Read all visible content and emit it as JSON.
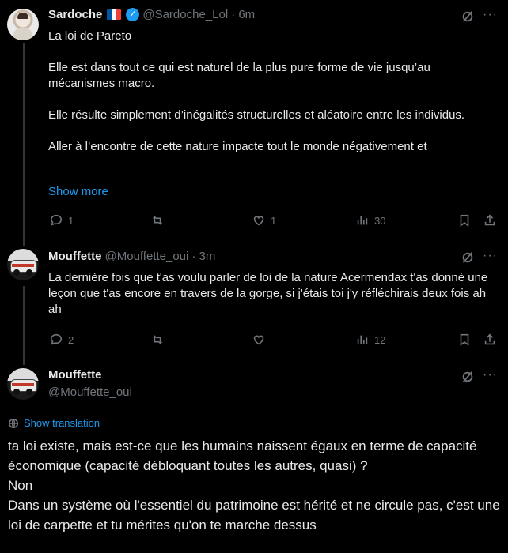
{
  "tweet1": {
    "name": "Sardoche",
    "handle": "@Sardoche_Lol",
    "time": "· 6m",
    "text": "La loi de Pareto\n\nElle est dans tout ce qui est naturel de la plus pure forme de vie jusqu’au mécanismes macro.\n\nElle résulte simplement d’inégalités structurelles et aléatoire entre les individus.\n\nAller à l’encontre de cette nature impacte tout le monde négativement et",
    "show_more": "Show more",
    "replies": "1",
    "retweets": "",
    "likes": "1",
    "views": "30"
  },
  "tweet2": {
    "name": "Mouffette",
    "handle": "@Mouffette_oui",
    "time": "· 3m",
    "text": "La dernière fois que t'as voulu parler de loi de la nature Acermendax t'as donné une leçon que t'as encore en travers de la gorge, si j'étais toi j'y réfléchirais deux fois ah ah",
    "replies": "2",
    "retweets": "",
    "likes": "",
    "views": "12"
  },
  "tweet3": {
    "name": "Mouffette",
    "handle": "@Mouffette_oui",
    "show_translation": "Show translation",
    "text": "ta loi existe, mais est-ce que les humains naissent égaux en terme de capacité économique (capacité débloquant toutes les autres, quasi) ?\nNon\nDans un système où l'essentiel du patrimoine est hérité et ne circule pas, c'est une loi de carpette et tu mérites qu'on te marche dessus"
  },
  "icons": {
    "more": "···",
    "verified_mark": "✓",
    "reply": "reply-icon",
    "retweet": "retweet-icon",
    "like": "heart-icon",
    "views": "analytics-icon",
    "bookmark": "bookmark-icon",
    "share": "share-icon",
    "grok": "grok-icon",
    "translate": "globe-icon"
  },
  "colors": {
    "background": "#000000",
    "text": "#e7e9ea",
    "muted": "#71767b",
    "accent": "#1d9bf0",
    "thread_line": "#333639"
  }
}
